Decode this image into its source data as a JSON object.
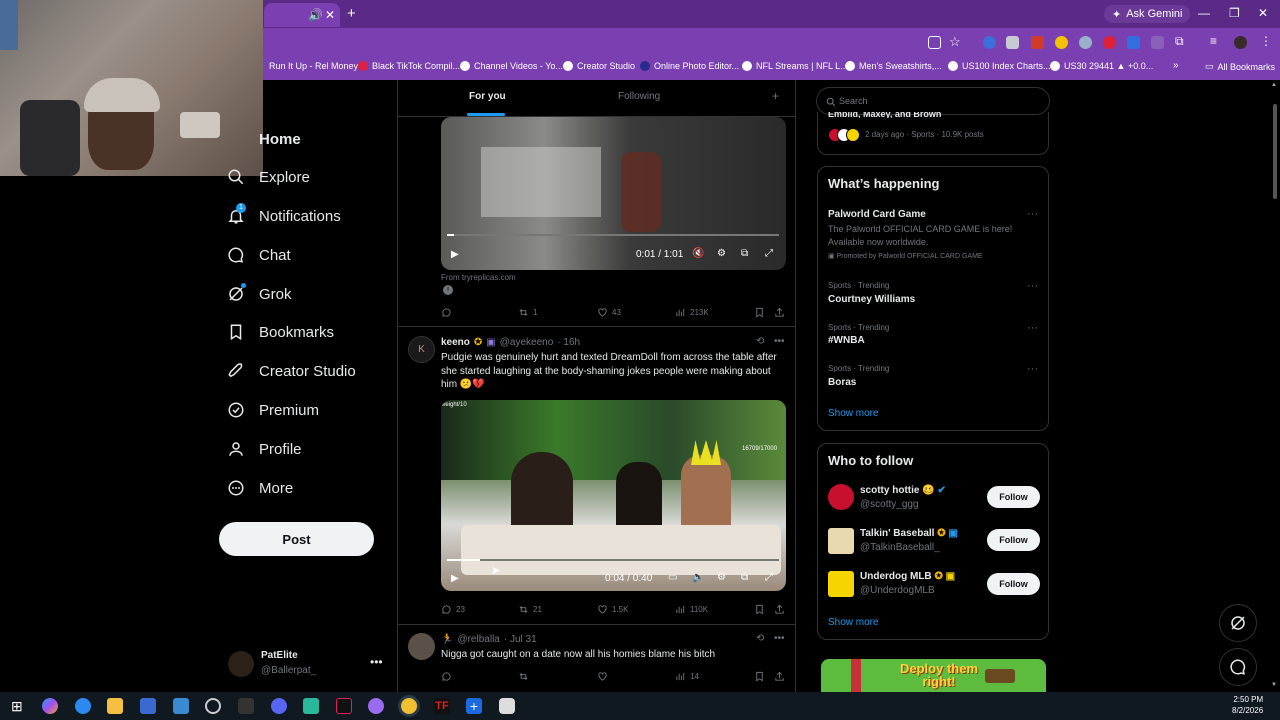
{
  "browser": {
    "gemini_label": "Ask Gemini",
    "bookmarks": [
      "Run It Up - Rel Money",
      "Black TikTok Compil...",
      "Channel Videos - Yo...",
      "Creator Studio",
      "Online Photo Editor...",
      "NFL Streams | NFL L...",
      "Men's Sweatshirts,...",
      "US100 Index Charts...",
      "US30 29441 ▲ +0.0..."
    ],
    "all_bookmarks": "All Bookmarks"
  },
  "nav": {
    "items": [
      "Home",
      "Explore",
      "Notifications",
      "Chat",
      "Grok",
      "Bookmarks",
      "Creator Studio",
      "Premium",
      "Profile",
      "More"
    ],
    "notifications_badge": "1",
    "post_label": "Post"
  },
  "account": {
    "name": "PatElite",
    "handle": "@Ballerpat_"
  },
  "timeline": {
    "tabs": {
      "for_you": "For you",
      "following": "Following"
    },
    "post1": {
      "video_time": "0:01 / 1:01",
      "source": "From tryreplicas.com",
      "replies": "",
      "retweets": "1",
      "likes": "43",
      "views": "213K"
    },
    "post2": {
      "author": "keeno",
      "handle": "@ayekeeno",
      "time": "· 16h",
      "text": "Pudgie was genuinely hurt and texted DreamDoll from across the table after she started laughing at the body-shaming jokes people were making about him 😕💔",
      "video_time": "0:04 / 0:40",
      "overlay_counter": "16709/17000",
      "overlay_corner": "weight/10",
      "replies": "23",
      "retweets": "21",
      "likes": "1.5K",
      "views": "110K"
    },
    "post3": {
      "handle": "@relballa",
      "time": "· Jul 31",
      "text": "Nigga got caught on a date now all his homies blame his bitch",
      "replies": "",
      "retweets": "",
      "likes": "",
      "views": "14"
    }
  },
  "right": {
    "search_placeholder": "Search",
    "top_partial": "Embiid, Maxey, and Brown",
    "top_meta": "2 days ago · Sports · 10.9K posts",
    "happening_title": "What’s happening",
    "trends": [
      {
        "meta": "",
        "title": "Palworld Card Game",
        "desc": "The Palworld OFFICIAL CARD GAME is here! Available now worldwide.",
        "promo": "Promoted by Palworld OFFICIAL CARD GAME"
      },
      {
        "meta": "Sports · Trending",
        "title": "Courtney Williams"
      },
      {
        "meta": "Sports · Trending",
        "title": "#WNBA"
      },
      {
        "meta": "Sports · Trending",
        "title": "Boras"
      }
    ],
    "show_more": "Show more",
    "wtf_title": "Who to follow",
    "follow_label": "Follow",
    "who_to_follow": [
      {
        "name": "scotty hottie 🥴",
        "handle": "@scotty_ggg",
        "color": "#c8102e"
      },
      {
        "name": "Talkin' Baseball",
        "handle": "@TalkinBaseball_",
        "color": "#e8d9b0"
      },
      {
        "name": "Underdog MLB",
        "handle": "@UnderdogMLB",
        "color": "#f5d400"
      }
    ],
    "ad_text": "Deploy them right!"
  },
  "taskbar": {
    "time": "2:50 PM",
    "date": "8/2/2026"
  },
  "colors": {
    "accent": "#1d9bf0",
    "chrome": "#7a3fb0",
    "bg": "#000000"
  }
}
